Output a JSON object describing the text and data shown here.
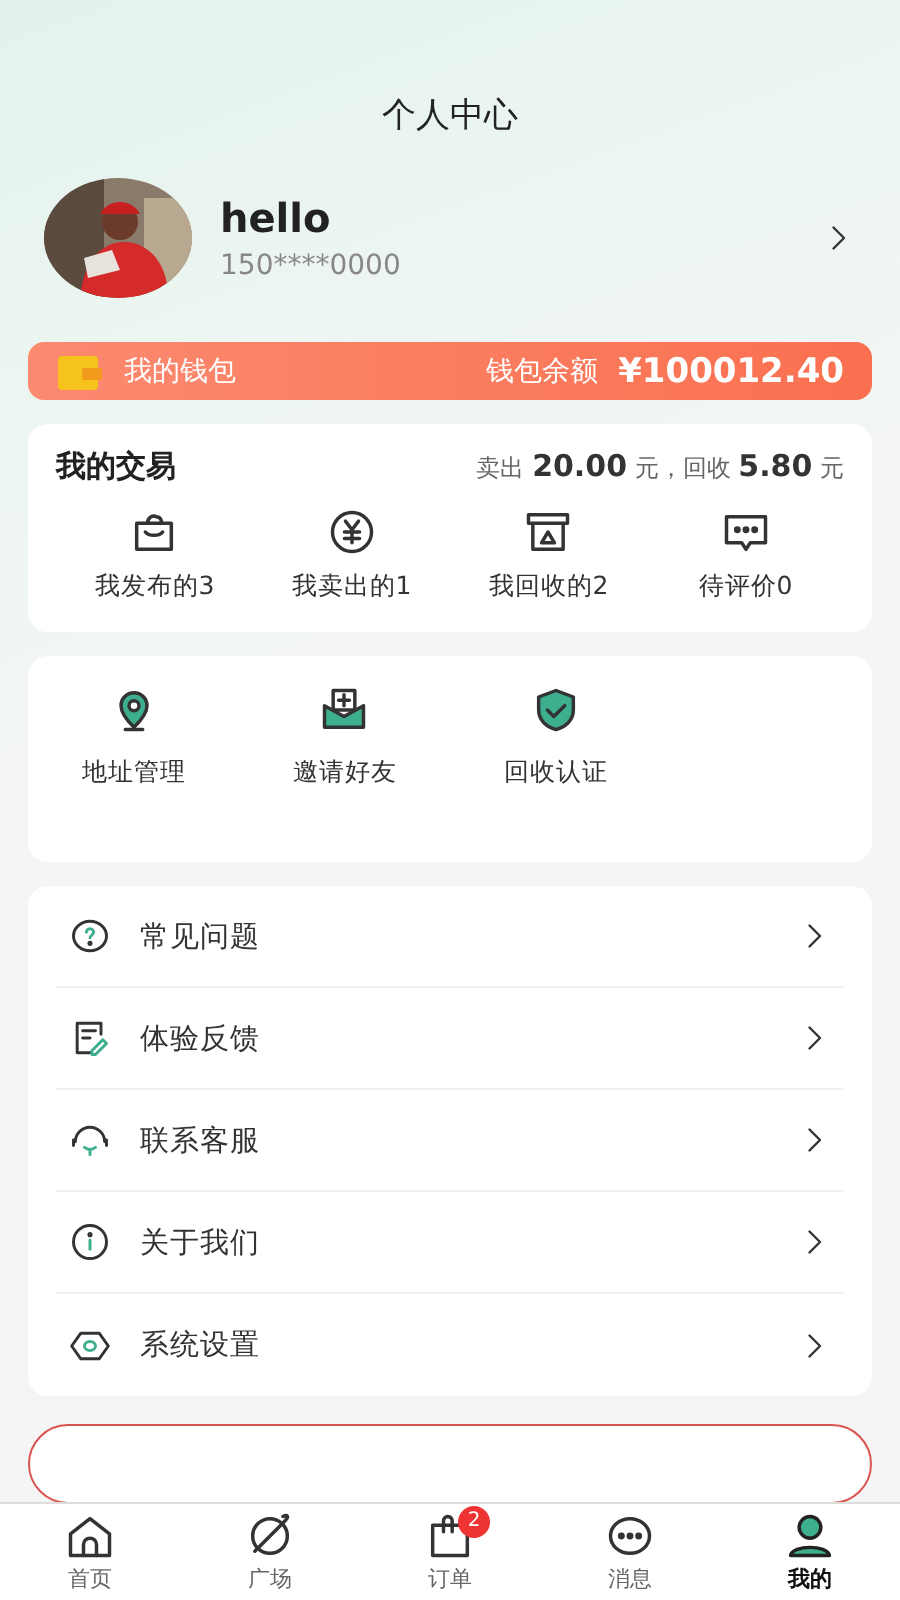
{
  "header": {
    "title": "个人中心"
  },
  "profile": {
    "name": "hello",
    "phone": "150****0000"
  },
  "wallet": {
    "label": "我的钱包",
    "balance_label": "钱包余额",
    "balance": "¥100012.40"
  },
  "trade": {
    "title": "我的交易",
    "summary": "卖出 **20.00** 元，回收 **5.80** 元",
    "items": [
      {
        "label": "我发布的3"
      },
      {
        "label": "我卖出的1"
      },
      {
        "label": "我回收的2"
      },
      {
        "label": "待评价0"
      }
    ]
  },
  "tools": [
    {
      "label": "地址管理"
    },
    {
      "label": "邀请好友"
    },
    {
      "label": "回收认证"
    }
  ],
  "menu": [
    {
      "label": "常见问题"
    },
    {
      "label": "体验反馈"
    },
    {
      "label": "联系客服"
    },
    {
      "label": "关于我们"
    },
    {
      "label": "系统设置"
    }
  ],
  "tab_bar": [
    {
      "label": "首页",
      "selected": false
    },
    {
      "label": "广场",
      "selected": false
    },
    {
      "label": "订单",
      "selected": false,
      "badge": "2"
    },
    {
      "label": "消息",
      "selected": false
    },
    {
      "label": "我的",
      "selected": true
    }
  ]
}
